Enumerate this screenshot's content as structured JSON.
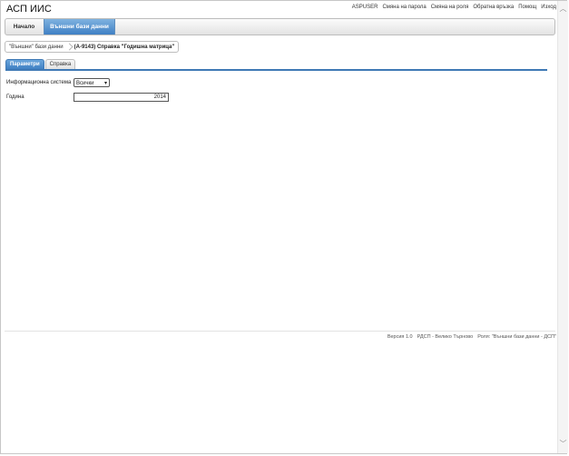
{
  "app": {
    "title": "АСП ИИС"
  },
  "top_links": [
    "ASPUSER",
    "Смяна на парола",
    "Смяна на роля",
    "Обратна връзка",
    "Помощ",
    "Изход"
  ],
  "menu": {
    "home": "Начало",
    "external": "Външни бази данни"
  },
  "breadcrumb": {
    "parent": "\"Външни\" бази данни",
    "current": "(А-9143) Справка \"Годишна матрица\""
  },
  "tabs": {
    "params": "Параметри",
    "report": "Справка"
  },
  "form": {
    "info_system_label": "Информационна система",
    "info_system_value": "Всички",
    "year_label": "Година",
    "year_value": "2014"
  },
  "footer": {
    "version": "Версия 1.0",
    "office": "РДСП - Велико Търново",
    "role": "Роля: \"Външни бази данни - ДСП\""
  },
  "icons": {
    "scroll_up": "chevron-up-icon",
    "scroll_down": "chevron-down-icon",
    "select_caret": "chevron-down-icon"
  }
}
